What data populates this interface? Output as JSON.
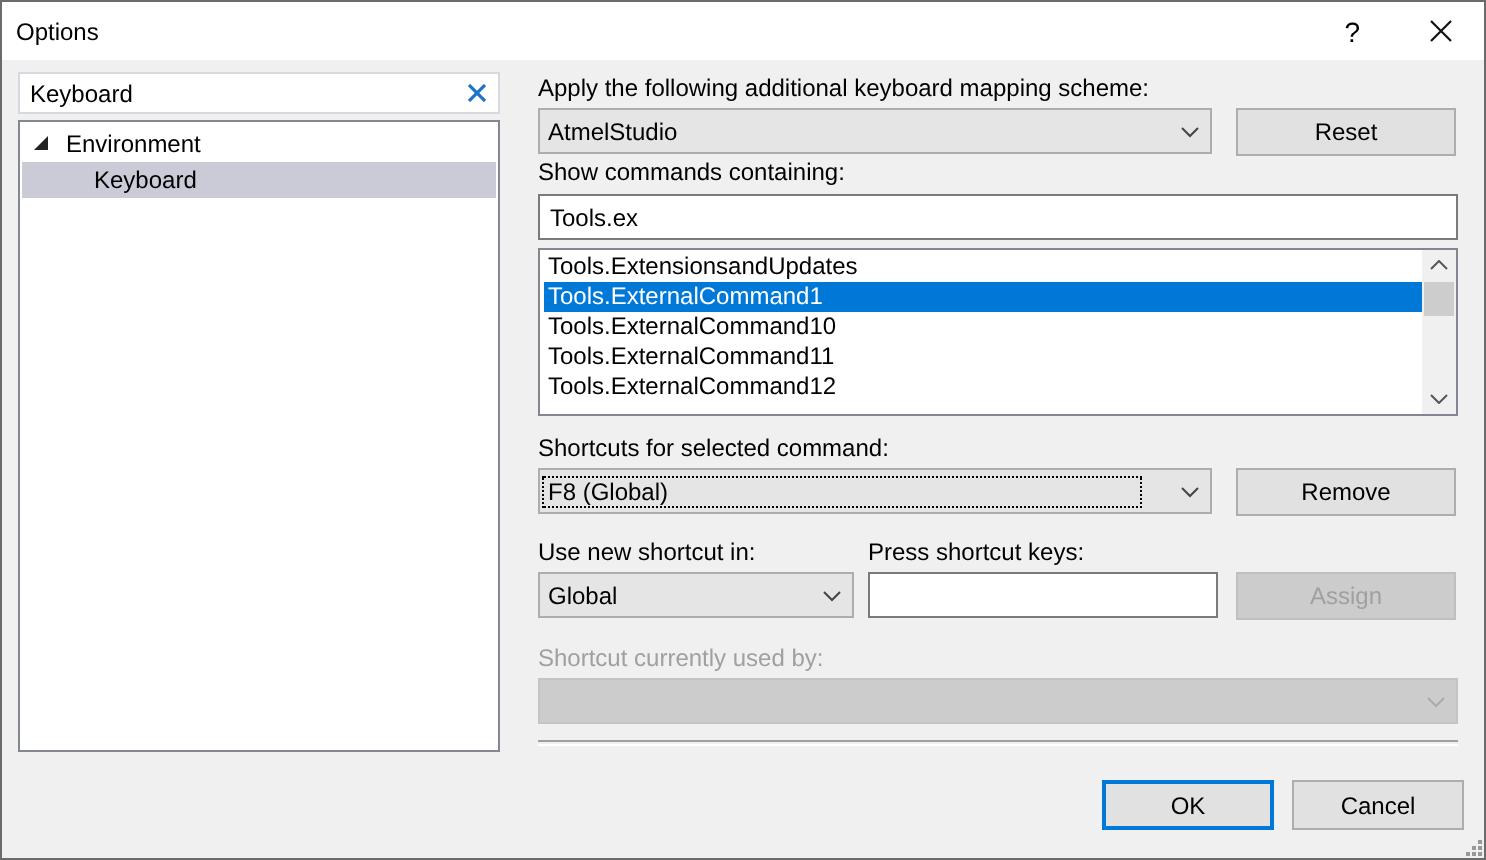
{
  "window": {
    "title": "Options",
    "help": "?"
  },
  "sidebar": {
    "search": {
      "value": "Keyboard"
    },
    "tree": [
      {
        "label": "Environment",
        "expanded": true,
        "selected": false,
        "children": [
          {
            "label": "Keyboard",
            "selected": true
          }
        ]
      }
    ]
  },
  "mapping": {
    "label": "Apply the following additional keyboard mapping scheme:",
    "value": "AtmelStudio",
    "button": "Reset"
  },
  "commands": {
    "label": "Show commands containing:",
    "value": "Tools.ex",
    "items": [
      {
        "label": "Tools.ExtensionsandUpdates",
        "selected": false
      },
      {
        "label": "Tools.ExternalCommand1",
        "selected": true
      },
      {
        "label": "Tools.ExternalCommand10",
        "selected": false
      },
      {
        "label": "Tools.ExternalCommand11",
        "selected": false
      },
      {
        "label": "Tools.ExternalCommand12",
        "selected": false
      }
    ]
  },
  "shortcuts": {
    "label": "Shortcuts for selected command:",
    "value": "F8 (Global)",
    "button": "Remove"
  },
  "new_shortcut": {
    "scope_label": "Use new shortcut in:",
    "scope_value": "Global",
    "keys_label": "Press shortcut keys:",
    "assign": {
      "label": "Assign",
      "disabled": true
    }
  },
  "used_by": {
    "label": "Shortcut currently used by:",
    "disabled": true
  },
  "buttons": [
    {
      "label": "OK",
      "default": true
    },
    {
      "label": "Cancel",
      "default": false
    }
  ]
}
